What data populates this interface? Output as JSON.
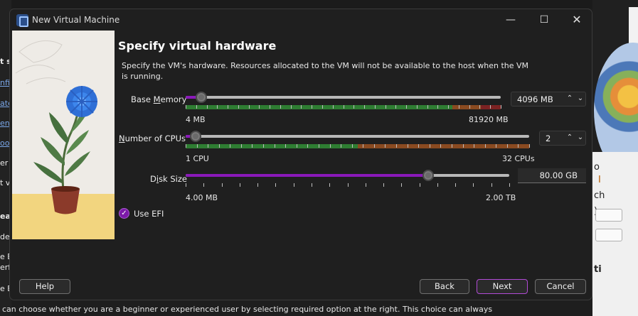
{
  "window": {
    "title": "New Virtual Machine",
    "minimize_glyph": "—",
    "maximize_glyph": "☐",
    "close_glyph": "✕"
  },
  "page": {
    "heading": "Specify virtual hardware",
    "description": "Specify the VM's hardware. Resources allocated to the VM will not be available to the host when the VM is running."
  },
  "memory": {
    "label_pre": "Base ",
    "label_u": "M",
    "label_post": "emory",
    "value": "4096 MB",
    "min": "4 MB",
    "max": "81920 MB",
    "level": 0.05
  },
  "cpus": {
    "label_u": "N",
    "label_post": "umber of CPUs",
    "value": "2",
    "min": "1 CPU",
    "max": "32 CPUs",
    "level": 0.03
  },
  "disk": {
    "label_pre": "D",
    "label_u": "i",
    "label_post": "sk Size",
    "value": "80.00 GB",
    "min": "4.00 MB",
    "max": "2.00 TB",
    "level": 0.75
  },
  "efi": {
    "label": "Use EFI",
    "checked": true
  },
  "buttons": {
    "help": "Help",
    "back": "Back",
    "next": "Next",
    "cancel": "Cancel"
  },
  "background": {
    "left_fragments": [
      "t s",
      "nfi",
      "ate",
      "en",
      "oon",
      "er t",
      "t v",
      "eas",
      "def",
      "e Ba",
      "erfa",
      "e Ex"
    ],
    "right_fragments": [
      "o",
      "I",
      "ch",
      ").",
      "ti"
    ],
    "bottom_text": "can choose whether you are a beginner or experienced user by selecting required option at the right. This choice can always"
  },
  "colors": {
    "accent": "#8a19b9",
    "safe_zone": "#2e7d32",
    "warn_zone": "#8a4a20",
    "danger_zone": "#7c2222"
  }
}
